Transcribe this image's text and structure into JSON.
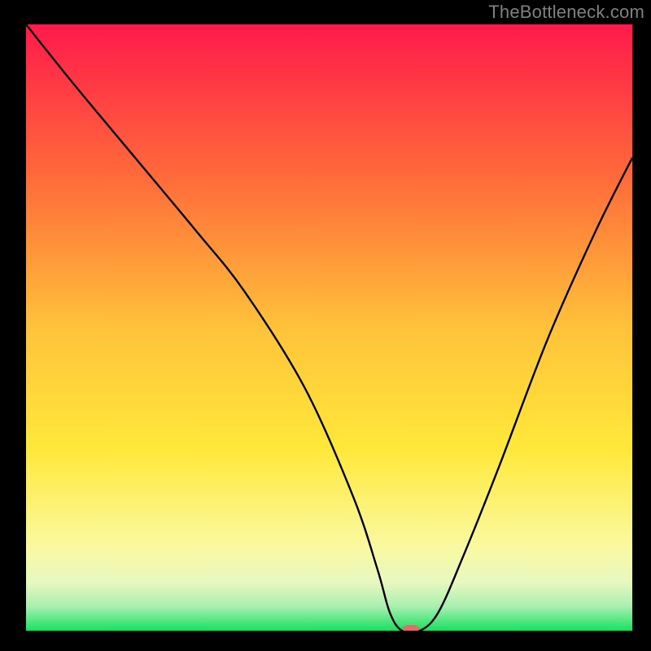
{
  "watermark": {
    "text": "TheBottleneck.com"
  },
  "chart_data": {
    "type": "line",
    "title": "",
    "xlabel": "",
    "ylabel": "",
    "xlim": [
      0,
      100
    ],
    "ylim": [
      0,
      100
    ],
    "curve": {
      "x": [
        0,
        8,
        18,
        28,
        36,
        46,
        54,
        58,
        60,
        62,
        65,
        68,
        72,
        78,
        86,
        94,
        100
      ],
      "values": [
        100,
        90,
        78,
        66,
        56,
        40,
        22,
        10,
        3,
        0,
        0,
        3,
        12,
        27,
        48,
        66,
        78
      ]
    },
    "marker": {
      "x": 63.5,
      "y": 0
    },
    "background_gradient": {
      "stops": [
        {
          "offset": 0.0,
          "color": "#ff1a4b"
        },
        {
          "offset": 0.25,
          "color": "#ff6a3a"
        },
        {
          "offset": 0.5,
          "color": "#ffc23a"
        },
        {
          "offset": 0.7,
          "color": "#ffe83a"
        },
        {
          "offset": 0.86,
          "color": "#faf9a0"
        },
        {
          "offset": 0.92,
          "color": "#e8f8c0"
        },
        {
          "offset": 0.96,
          "color": "#a8f0b0"
        },
        {
          "offset": 1.0,
          "color": "#18e060"
        }
      ]
    },
    "marker_style": {
      "fill": "#d9716b",
      "rx": 7
    }
  }
}
